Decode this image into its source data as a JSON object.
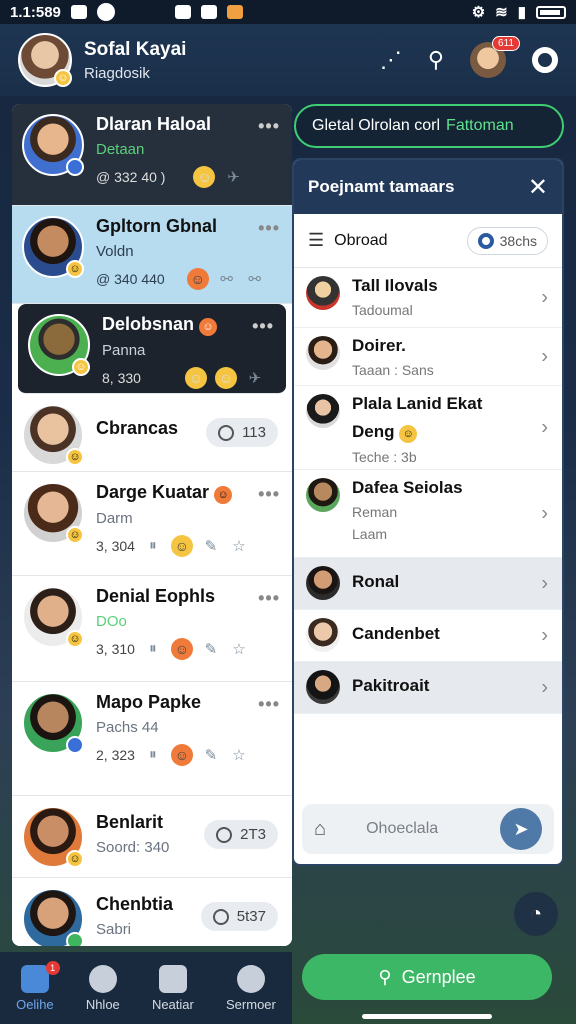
{
  "status_bar": {
    "time": "1.1:589"
  },
  "header": {
    "title": "Sofal Kayai",
    "subtitle": "Riagdosik",
    "notif_count": "611"
  },
  "chats": [
    {
      "name": "Dlaran Haloal",
      "sub": "Detaan",
      "meta": "@ 332 40 )"
    },
    {
      "name": "Gpltorn Gbnal",
      "sub": "Voldn",
      "meta": "@ 340 440"
    },
    {
      "name": "Delobsnan",
      "sub": "Panna",
      "meta": "8, 330"
    },
    {
      "name": "Cbrancas",
      "sub": "",
      "meta": "",
      "count": "113"
    },
    {
      "name": "Darge Kuatar",
      "sub": "Darm",
      "meta": "3, 304"
    },
    {
      "name": "Denial Eophls",
      "sub": "DOo",
      "meta": "3, 310"
    },
    {
      "name": "Mapo Papke",
      "sub": "Pachs 44",
      "meta": "2, 323"
    },
    {
      "name": "Benlarit",
      "sub": "Soord: 340",
      "meta": "",
      "count": "2T3"
    },
    {
      "name": "Chenbtia",
      "sub": "Sabri",
      "meta": "",
      "count": "5t37"
    }
  ],
  "top_chip": {
    "label": "Gletal Olrolan сorl",
    "highlight": "Fattoman"
  },
  "panel": {
    "title": "Poejnamt tamaars",
    "filter_label": "Obroad",
    "filter_pill": "38chs",
    "contacts": [
      {
        "name": "Tall Ilovals",
        "sub": "Tadoumal"
      },
      {
        "name": "Doirer.",
        "sub": "Taaan : Sans"
      },
      {
        "name": "Plala Lanid Ekat",
        "sub": ""
      },
      {
        "name": "Deng",
        "sub": "Teche : 3b"
      },
      {
        "name": "Dafea Seiolas",
        "sub": "Reman"
      },
      {
        "name": "",
        "sub": "Laam"
      },
      {
        "name": "Ronal",
        "sub": ""
      },
      {
        "name": "Candenbet",
        "sub": ""
      },
      {
        "name": "Pakitroait",
        "sub": ""
      }
    ],
    "footer_label": "Ohoeclala"
  },
  "bottom_nav": [
    {
      "label": "Oelihe"
    },
    {
      "label": "Nhloe"
    },
    {
      "label": "Neatiar"
    },
    {
      "label": "Sermoer"
    }
  ],
  "primary_button": "Gernplee",
  "colors": {
    "accent_green": "#3cb765",
    "header_blue": "#22395a",
    "active_blue": "#4a88d8"
  }
}
